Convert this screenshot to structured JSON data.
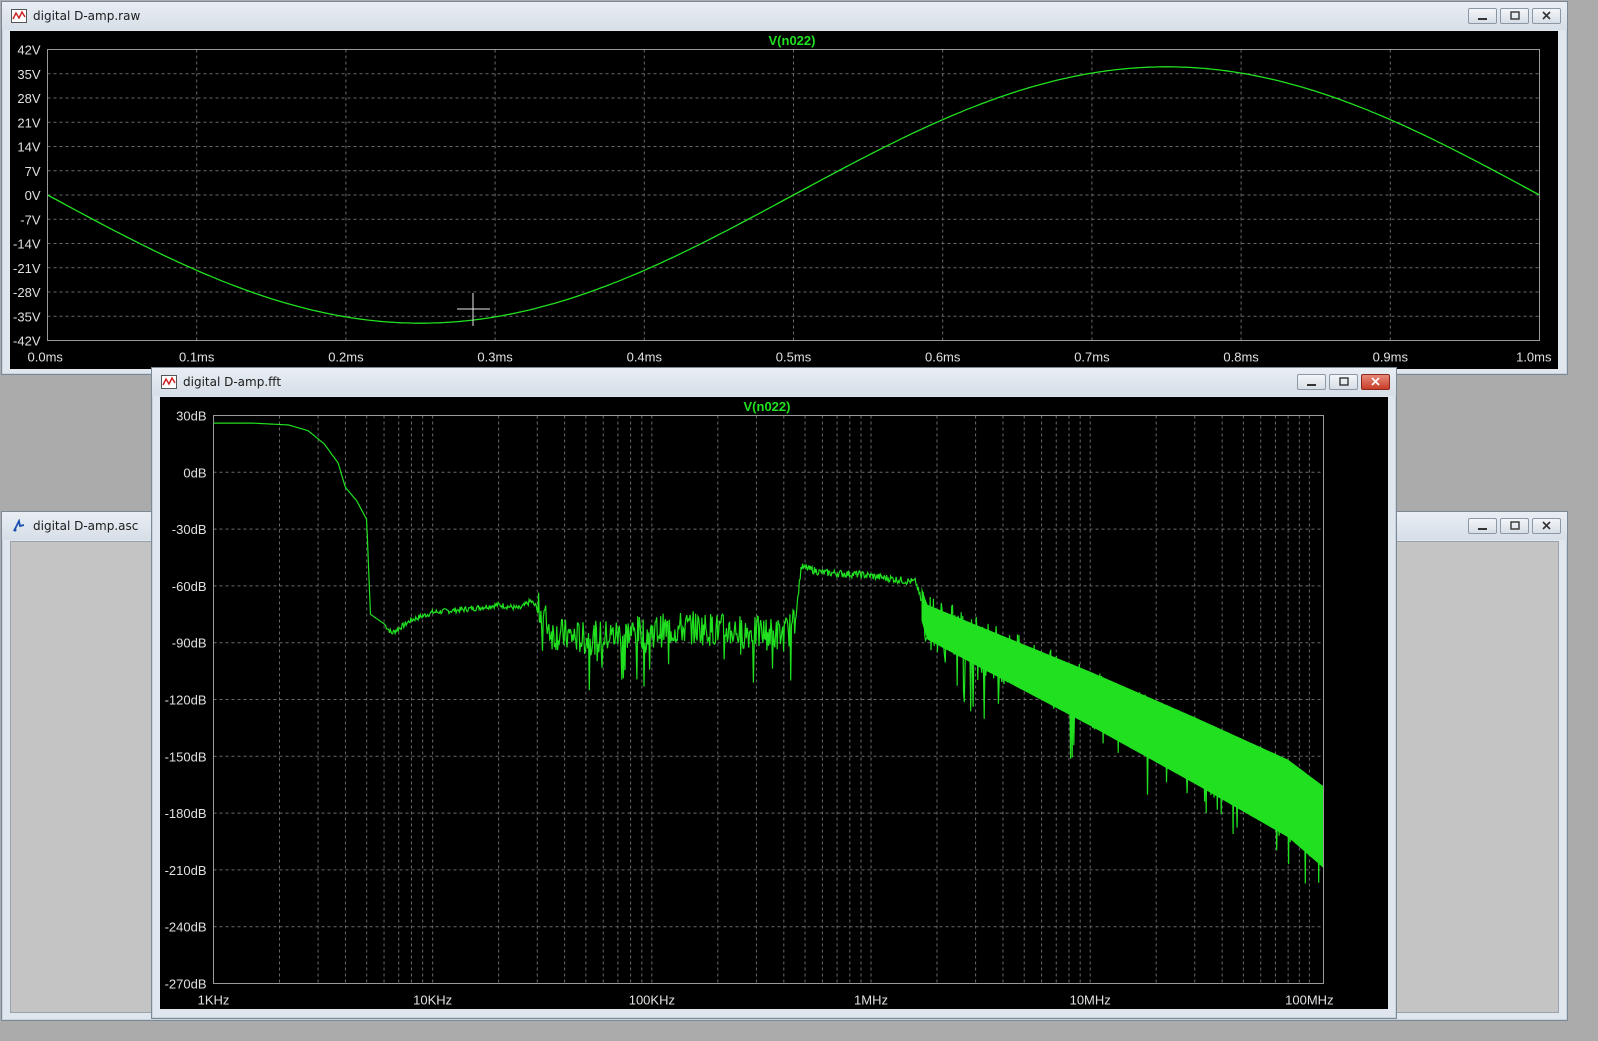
{
  "windows": {
    "raw": {
      "title": "digital D-amp.raw",
      "trace_name": "V(n022)"
    },
    "fft": {
      "title": "digital D-amp.fft",
      "trace_name": "V(n022)"
    },
    "asc": {
      "title": "digital D-amp.asc"
    }
  },
  "colors": {
    "trace": "#20e020",
    "plot_bg": "#000000",
    "desktop": "#ababab"
  },
  "chart_data": [
    {
      "type": "line",
      "xlabel": "",
      "ylabel": "",
      "title": "V(n022)",
      "x_ticks": [
        "0.0ms",
        "0.1ms",
        "0.2ms",
        "0.3ms",
        "0.4ms",
        "0.5ms",
        "0.6ms",
        "0.7ms",
        "0.8ms",
        "0.9ms",
        "1.0ms"
      ],
      "y_ticks": [
        "42V",
        "35V",
        "28V",
        "21V",
        "14V",
        "7V",
        "0V",
        "-7V",
        "-14V",
        "-21V",
        "-28V",
        "-35V",
        "-42V"
      ],
      "xlim": [
        0,
        1.0
      ],
      "ylim": [
        -42,
        42
      ],
      "series": [
        {
          "name": "V(n022)",
          "shape": "sine",
          "amplitude": 37,
          "period_ms": 1.0,
          "phase": "inverted"
        }
      ]
    },
    {
      "type": "line",
      "title": "V(n022)",
      "xlabel": "",
      "ylabel": "",
      "x_scale": "log",
      "x_ticks": [
        "1KHz",
        "10KHz",
        "100KHz",
        "1MHz",
        "10MHz",
        "100MHz"
      ],
      "y_ticks": [
        "30dB",
        "0dB",
        "-30dB",
        "-60dB",
        "-90dB",
        "-120dB",
        "-150dB",
        "-180dB",
        "-210dB",
        "-240dB",
        "-270dB"
      ],
      "xlim": [
        1000,
        116000000
      ],
      "ylim": [
        -270,
        30
      ],
      "series": [
        {
          "name": "V(n022)",
          "points": [
            [
              1000,
              26
            ],
            [
              1500,
              26
            ],
            [
              2200,
              25
            ],
            [
              2700,
              22
            ],
            [
              3200,
              15
            ],
            [
              3700,
              5
            ],
            [
              4000,
              -8
            ],
            [
              4500,
              -15
            ],
            [
              5000,
              -25
            ],
            [
              5200,
              -75
            ],
            [
              6000,
              -80
            ],
            [
              6500,
              -85
            ],
            [
              8000,
              -78
            ],
            [
              10000,
              -74
            ],
            [
              15000,
              -72
            ],
            [
              20000,
              -70
            ],
            [
              25000,
              -72
            ],
            [
              28000,
              -68
            ],
            [
              32000,
              -75
            ],
            [
              35000,
              -85
            ],
            [
              50000,
              -88
            ],
            [
              80000,
              -85
            ],
            [
              150000,
              -82
            ],
            [
              250000,
              -84
            ],
            [
              400000,
              -86
            ],
            [
              450000,
              -80
            ],
            [
              480000,
              -50
            ],
            [
              600000,
              -53
            ],
            [
              900000,
              -54
            ],
            [
              1200000,
              -56
            ],
            [
              1600000,
              -58
            ],
            [
              1800000,
              -78
            ],
            [
              3000000,
              -90
            ],
            [
              10000000,
              -118
            ],
            [
              30000000,
              -145
            ],
            [
              80000000,
              -170
            ],
            [
              116000000,
              -185
            ]
          ]
        }
      ]
    }
  ]
}
